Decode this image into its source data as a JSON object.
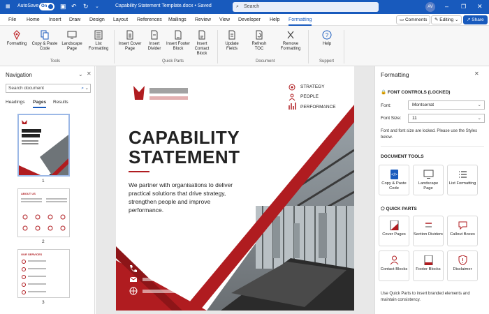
{
  "titlebar": {
    "autosave_label": "AutoSave",
    "autosave_state": "On",
    "doc_title": "Capability Statement Template.docx • Saved",
    "search_placeholder": "Search",
    "avatar_initials": "AV"
  },
  "menu": {
    "items": [
      "File",
      "Home",
      "Insert",
      "Draw",
      "Design",
      "Layout",
      "References",
      "Mailings",
      "Review",
      "View",
      "Developer",
      "Help",
      "Formatting"
    ],
    "active": "Formatting",
    "comments_label": "Comments",
    "editing_label": "Editing",
    "share_label": "Share"
  },
  "ribbon": {
    "tools": [
      "Formatting",
      "Copy & Paste Code",
      "Landscape Page",
      "List Formatting"
    ],
    "tools_group": "Tools",
    "quickparts": [
      "Insert Cover Page",
      "Insert Divider",
      "Insert Footer Block",
      "Insert Contact Block"
    ],
    "quickparts_group": "Quick Parts",
    "document": [
      "Update Fields",
      "Refresh TOC",
      "Remove Formatting"
    ],
    "document_group": "Document",
    "support": [
      "Help"
    ],
    "support_group": "Support"
  },
  "nav": {
    "title": "Navigation",
    "search_placeholder": "Search document",
    "tabs": [
      "Headings",
      "Pages",
      "Results"
    ],
    "active_tab": "Pages",
    "page_numbers": [
      "1",
      "2",
      "3"
    ],
    "thumb2_heading": "ABOUT US",
    "thumb3_heading": "OUR SERVICES"
  },
  "doc": {
    "heading_line1": "CAPABILITY",
    "heading_line2": "STATEMENT",
    "intro": "We partner with organisations to deliver practical solutions that drive strategy, strengthen people and improve performance.",
    "features": [
      "STRATEGY",
      "PEOPLE",
      "PERFORMANCE"
    ],
    "accent_color": "#b01c20"
  },
  "panel": {
    "title": "Formatting",
    "font_section": "FONT CONTROLS (LOCKED)",
    "font_label": "Font:",
    "font_value": "Montserrat",
    "size_label": "Font Size:",
    "size_value": "11",
    "font_note": "Font and font size are locked. Please use the Styles below.",
    "tools_section": "DOCUMENT TOOLS",
    "tools": [
      "Copy & Paste Code",
      "Landscape Page",
      "List Formatting"
    ],
    "quick_section": "QUICK PARTS",
    "quick": [
      "Cover Pages",
      "Section Dividers",
      "Callout Boxes",
      "Contact Blocks",
      "Footer Blocks",
      "Disclaimer"
    ],
    "quick_note": "Use Quick Parts to insert branded elements and maintain consistency."
  }
}
